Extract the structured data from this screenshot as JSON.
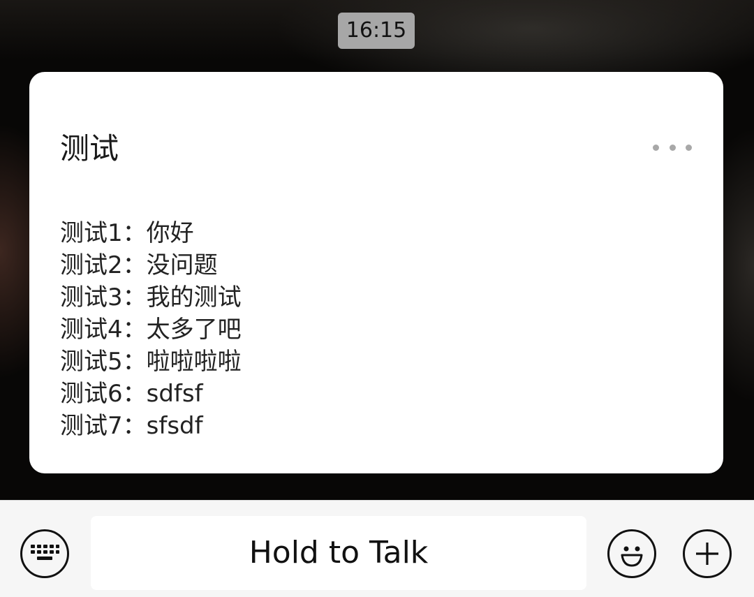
{
  "chat": {
    "timestamp": "16:15"
  },
  "message_card": {
    "title": "测试",
    "lines": [
      "测试1：你好",
      "测试2：没问题",
      "测试3：我的测试",
      "测试4：太多了吧",
      "测试5：啦啦啦啦",
      "测试6：sdfsf",
      "测试7：sfsdf"
    ],
    "more_icon": "more-dots-icon"
  },
  "input_bar": {
    "hold_to_talk_label": "Hold to Talk",
    "keyboard_icon": "keyboard-icon",
    "emoji_icon": "emoji-icon",
    "plus_icon": "plus-icon"
  },
  "colors": {
    "card_bg": "#ffffff",
    "timestamp_bg": "#a7a7a7",
    "input_bar_bg": "#f6f6f6"
  }
}
